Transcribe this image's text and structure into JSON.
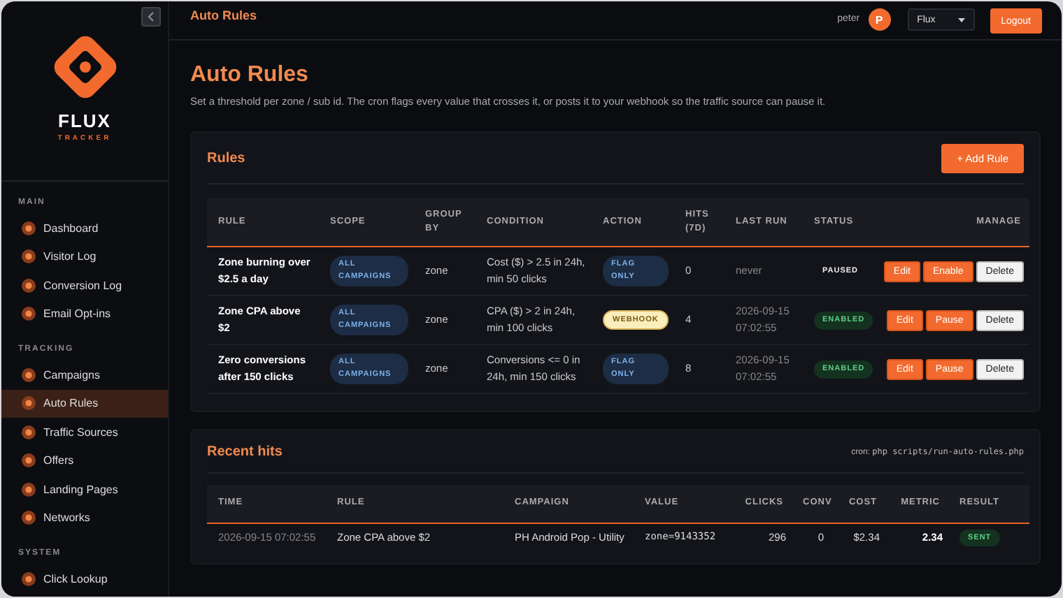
{
  "sidebar": {
    "logo": {
      "name": "FLUX",
      "tagline": "TRACKER"
    },
    "sections": [
      {
        "title": "MAIN",
        "items": [
          {
            "label": "Dashboard",
            "selected": false
          },
          {
            "label": "Visitor Log",
            "selected": false
          },
          {
            "label": "Conversion Log",
            "selected": false
          },
          {
            "label": "Email Opt-ins",
            "selected": false
          }
        ]
      },
      {
        "title": "TRACKING",
        "items": [
          {
            "label": "Campaigns",
            "selected": false
          },
          {
            "label": "Auto Rules",
            "selected": true
          },
          {
            "label": "Traffic Sources",
            "selected": false
          },
          {
            "label": "Offers",
            "selected": false
          },
          {
            "label": "Landing Pages",
            "selected": false
          },
          {
            "label": "Networks",
            "selected": false
          }
        ]
      },
      {
        "title": "SYSTEM",
        "items": [
          {
            "label": "Click Lookup",
            "selected": false
          }
        ]
      }
    ]
  },
  "topbar": {
    "title": "Auto Rules",
    "user": "peter",
    "avatar": "P",
    "workspace": "Flux",
    "logout": "Logout"
  },
  "page": {
    "title": "Auto Rules",
    "subtitle": "Set a threshold per zone / sub id. The cron flags every value that crosses it, or posts it to your webhook so the traffic source can pause it."
  },
  "rules": {
    "title": "Rules",
    "add_button": "+ Add Rule",
    "columns": [
      "RULE",
      "SCOPE",
      "GROUP BY",
      "CONDITION",
      "ACTION",
      "HITS (7D)",
      "LAST RUN",
      "STATUS",
      "MANAGE"
    ],
    "rows": [
      {
        "name": "Zone burning over $2.5 a day",
        "scope": "ALL CAMPAIGNS",
        "group_by": "zone",
        "condition": "Cost ($) > 2.5 in 24h, min 50 clicks",
        "action": {
          "label": "FLAG ONLY",
          "kind": "flag"
        },
        "hits": "0",
        "last_run": "never",
        "status": {
          "label": "PAUSED",
          "kind": "paused"
        },
        "buttons": [
          {
            "label": "Edit",
            "kind": "primary"
          },
          {
            "label": "Enable",
            "kind": "primary"
          },
          {
            "label": "Delete",
            "kind": "light"
          }
        ]
      },
      {
        "name": "Zone CPA above $2",
        "scope": "ALL CAMPAIGNS",
        "group_by": "zone",
        "condition": "CPA ($) > 2 in 24h, min 100 clicks",
        "action": {
          "label": "WEBHOOK",
          "kind": "webhook"
        },
        "hits": "4",
        "last_run": "2026-09-15 07:02:55",
        "status": {
          "label": "ENABLED",
          "kind": "enabled"
        },
        "buttons": [
          {
            "label": "Edit",
            "kind": "primary"
          },
          {
            "label": "Pause",
            "kind": "primary"
          },
          {
            "label": "Delete",
            "kind": "light"
          }
        ]
      },
      {
        "name": "Zero conversions after 150 clicks",
        "scope": "ALL CAMPAIGNS",
        "group_by": "zone",
        "condition": "Conversions <= 0 in 24h, min 150 clicks",
        "action": {
          "label": "FLAG ONLY",
          "kind": "flag"
        },
        "hits": "8",
        "last_run": "2026-09-15 07:02:55",
        "status": {
          "label": "ENABLED",
          "kind": "enabled"
        },
        "buttons": [
          {
            "label": "Edit",
            "kind": "primary"
          },
          {
            "label": "Pause",
            "kind": "primary"
          },
          {
            "label": "Delete",
            "kind": "light"
          }
        ]
      }
    ]
  },
  "recent_hits": {
    "title": "Recent hits",
    "cron_label": "cron:",
    "cron_command": "php scripts/run-auto-rules.php",
    "columns": [
      "TIME",
      "RULE",
      "CAMPAIGN",
      "VALUE",
      "CLICKS",
      "CONV",
      "COST",
      "METRIC",
      "RESULT"
    ],
    "rows": [
      {
        "time": "2026-09-15 07:02:55",
        "rule": "Zone CPA above $2",
        "campaign": "PH Android Pop - Utility",
        "value": "zone=9143352",
        "clicks": "296",
        "conv": "0",
        "cost": "$2.34",
        "metric": "2.34",
        "result": {
          "label": "SENT",
          "kind": "sent"
        }
      }
    ]
  }
}
